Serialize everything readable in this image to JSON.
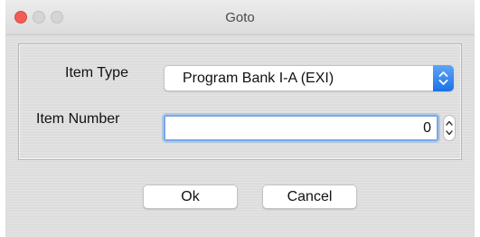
{
  "window": {
    "title": "Goto"
  },
  "form": {
    "item_type_label": "Item Type",
    "item_type_value": "Program Bank I-A (EXI)",
    "item_number_label": "Item Number",
    "item_number_value": "0"
  },
  "buttons": {
    "ok": "Ok",
    "cancel": "Cancel"
  },
  "colors": {
    "accent": "#1a72e6",
    "close": "#f25b57",
    "focus_ring": "#7aa9e8"
  },
  "icons": {
    "select_arrows": "up-down-chevron-icon",
    "stepper": "stepper-arrows-icon"
  }
}
